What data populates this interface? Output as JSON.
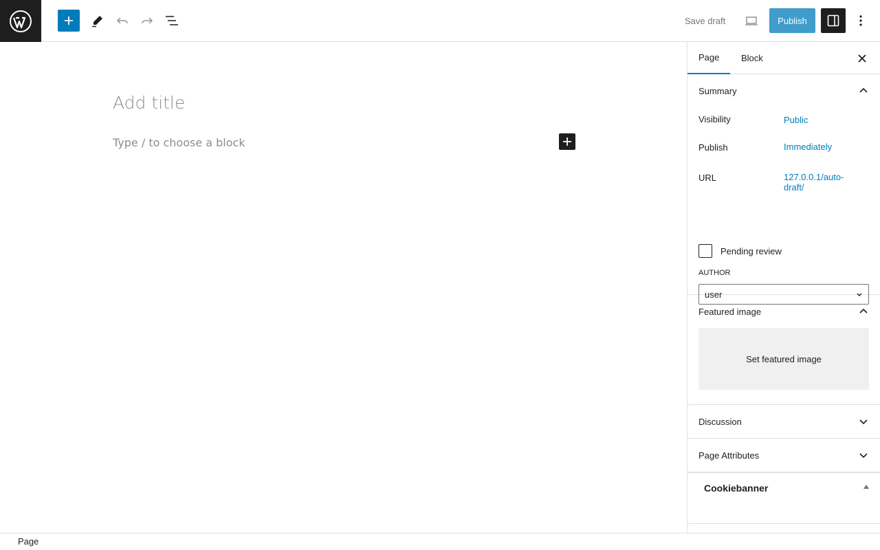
{
  "toolbar": {
    "save_draft": "Save draft",
    "publish": "Publish",
    "icons": [
      "wordpress-logo",
      "plus-icon",
      "pencil-icon",
      "undo-icon",
      "redo-icon",
      "list-view-icon",
      "desktop-preview-icon",
      "settings-sidebar-icon",
      "more-vertical-icon"
    ]
  },
  "editor": {
    "title_placeholder": "Add title",
    "block_placeholder": "Type / to choose a block"
  },
  "sidebar": {
    "tabs": [
      {
        "label": "Page",
        "active": true
      },
      {
        "label": "Block",
        "active": false
      }
    ],
    "summary": {
      "title": "Summary",
      "visibility_label": "Visibility",
      "visibility_value": "Public",
      "publish_label": "Publish",
      "publish_value": "Immediately",
      "url_label": "URL",
      "url_value": "127.0.0.1/auto-draft/",
      "pending_label": "Pending review",
      "pending_checked": false,
      "author_label": "AUTHOR",
      "author_value": "user"
    },
    "featured": {
      "title": "Featured image",
      "button": "Set featured image"
    },
    "discussion": {
      "title": "Discussion"
    },
    "page_attributes": {
      "title": "Page Attributes"
    },
    "cookiebanner": {
      "title": "Cookiebanner"
    }
  },
  "footer": {
    "breadcrumb": "Page"
  },
  "colors": {
    "accent": "#007cba",
    "dark": "#1e1e1e",
    "muted": "#757575"
  }
}
